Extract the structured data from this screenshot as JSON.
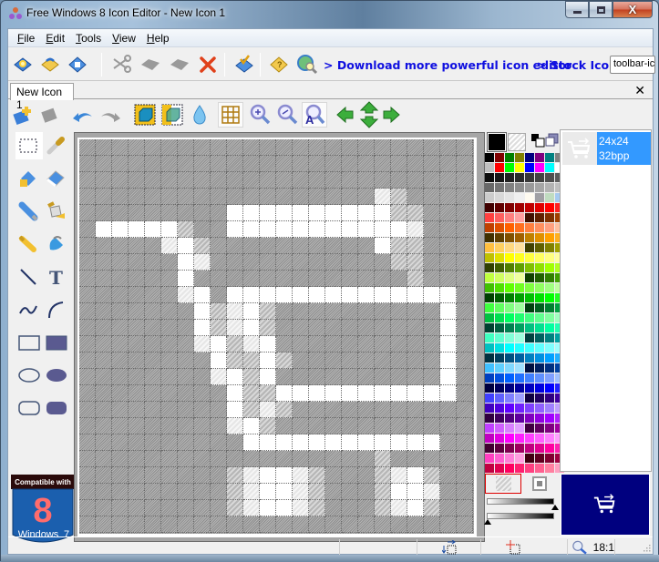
{
  "window": {
    "title": "Free Windows 8 Icon Editor - New Icon 1",
    "caption": {
      "minimize": "minimize",
      "maximize": "maximize",
      "close": "X"
    }
  },
  "menu": [
    {
      "label": "File",
      "accel": "F",
      "rest": "ile"
    },
    {
      "label": "Edit",
      "accel": "E",
      "rest": "dit"
    },
    {
      "label": "Tools",
      "accel": "T",
      "rest": "ools"
    },
    {
      "label": "View",
      "accel": "V",
      "rest": "iew"
    },
    {
      "label": "Help",
      "accel": "H",
      "rest": "elp"
    }
  ],
  "toolbar": {
    "buttons": [
      {
        "name": "new-icon",
        "icon": "new-sparkle-icon",
        "enabled": true
      },
      {
        "name": "open",
        "icon": "open-folder-icon",
        "enabled": true
      },
      {
        "name": "save",
        "icon": "save-disk-icon",
        "enabled": true
      },
      {
        "name": "cut",
        "icon": "scissors-icon",
        "enabled": false
      },
      {
        "name": "copy",
        "icon": "copy-icon",
        "enabled": false
      },
      {
        "name": "paste",
        "icon": "paste-icon",
        "enabled": false
      },
      {
        "name": "delete",
        "icon": "delete-x-icon",
        "enabled": true
      },
      {
        "name": "import",
        "icon": "import-check-icon",
        "enabled": true
      },
      {
        "name": "help",
        "icon": "help-book-icon",
        "enabled": true
      },
      {
        "name": "search",
        "icon": "globe-search-icon",
        "enabled": true
      }
    ],
    "links": [
      "> Download more powerful icon editor",
      "> Stock Icons"
    ],
    "combo_value": "toolbar-ic"
  },
  "tabs": [
    {
      "label": "New Icon 1",
      "active": true
    }
  ],
  "tab_close": "✕",
  "edit_toolbar": [
    {
      "name": "add-image",
      "icon": "add-image-icon",
      "enabled": true
    },
    {
      "name": "remove-image",
      "icon": "remove-image-icon",
      "enabled": false
    },
    {
      "name": "undo",
      "icon": "undo-icon",
      "enabled": true
    },
    {
      "name": "redo",
      "icon": "redo-icon",
      "enabled": false
    },
    {
      "name": "opaque-mode",
      "icon": "opaque-cube-icon",
      "enabled": true
    },
    {
      "name": "transparent-mode",
      "icon": "transparent-cube-icon",
      "enabled": true
    },
    {
      "name": "drop-shadow",
      "icon": "water-drop-icon",
      "enabled": true
    },
    {
      "name": "grid",
      "icon": "grid-icon",
      "enabled": true,
      "pressed": true
    },
    {
      "name": "zoom-in",
      "icon": "zoom-in-icon",
      "enabled": true
    },
    {
      "name": "zoom-out",
      "icon": "zoom-out-icon",
      "enabled": true
    },
    {
      "name": "zoom-fit",
      "icon": "zoom-fit-icon",
      "enabled": true,
      "pressed": true
    },
    {
      "name": "move-left",
      "icon": "arrow-left-icon",
      "enabled": true
    },
    {
      "name": "move-up-down",
      "icon": "arrow-up-down-icon",
      "enabled": true
    },
    {
      "name": "move-right",
      "icon": "arrow-right-icon",
      "enabled": true
    }
  ],
  "tools": [
    {
      "name": "select-rect",
      "icon": "marquee-icon",
      "active": true
    },
    {
      "name": "color-picker",
      "icon": "eyedropper-icon"
    },
    {
      "name": "eraser-fill",
      "icon": "eraser-bucket-icon"
    },
    {
      "name": "eraser",
      "icon": "eraser-icon"
    },
    {
      "name": "pencil",
      "icon": "pencil-icon"
    },
    {
      "name": "fill",
      "icon": "paint-bucket-icon"
    },
    {
      "name": "brush",
      "icon": "brush-icon"
    },
    {
      "name": "airbrush",
      "icon": "spray-icon"
    },
    {
      "name": "line",
      "icon": "line-icon"
    },
    {
      "name": "text",
      "icon": "text-icon",
      "glyph": "T"
    },
    {
      "name": "curve",
      "icon": "curve-icon"
    },
    {
      "name": "arc",
      "icon": "arc-icon"
    },
    {
      "name": "rectangle",
      "icon": "rectangle-outline-icon"
    },
    {
      "name": "filled-rectangle",
      "icon": "rectangle-filled-icon"
    },
    {
      "name": "ellipse",
      "icon": "ellipse-outline-icon"
    },
    {
      "name": "filled-ellipse",
      "icon": "ellipse-filled-icon"
    },
    {
      "name": "rounded-rectangle",
      "icon": "rounded-rect-outline-icon"
    },
    {
      "name": "filled-rounded-rectangle",
      "icon": "rounded-rect-filled-icon"
    }
  ],
  "compat_badge": {
    "top": "Compatible with",
    "number": "8",
    "bottom": "Windows",
    "suffix": "7"
  },
  "canvas": {
    "size": 24,
    "pixels": {
      "w": [
        "5:1",
        "5:2",
        "5:3",
        "5:4",
        "5:5",
        "6:6",
        "7:6",
        "8:6",
        "9:7",
        "10:7",
        "11:7",
        "12:8",
        "13:8",
        "14:9",
        "15:9",
        "16:9",
        "17:10",
        "18:10",
        "4:9",
        "4:10",
        "4:11",
        "4:12",
        "4:13",
        "4:14",
        "4:15",
        "4:16",
        "4:17",
        "4:18",
        "5:9",
        "5:10",
        "5:11",
        "5:12",
        "5:13",
        "5:14",
        "5:15",
        "5:16",
        "5:17",
        "5:18",
        "5:19",
        "6:18",
        "9:9",
        "9:10",
        "9:11",
        "9:12",
        "9:13",
        "9:14",
        "9:15",
        "9:16",
        "9:17",
        "9:18",
        "9:19",
        "9:20",
        "9:21",
        "9:22",
        "10:22",
        "11:22",
        "12:22",
        "13:22",
        "14:22",
        "15:12",
        "15:13",
        "15:14",
        "15:15",
        "15:16",
        "15:17",
        "15:18",
        "15:19",
        "15:20",
        "15:21",
        "15:22",
        "10:10",
        "11:10",
        "12:11",
        "13:11",
        "14:11",
        "18:10",
        "18:11",
        "18:12",
        "18:13",
        "18:14",
        "18:15",
        "18:16",
        "18:17",
        "18:18",
        "18:19",
        "18:20",
        "18:21",
        "20:11",
        "20:12",
        "21:11",
        "21:12",
        "22:11",
        "22:12",
        "20:20",
        "21:19",
        "21:20",
        "22:20"
      ],
      "l": [
        "3:18",
        "5:19_",
        "6:5",
        "7:7",
        "9:6",
        "9:7",
        "10:9",
        "12:10",
        "12:7",
        "14:8",
        "17:10",
        "16:11",
        "17:9",
        "6:19",
        "5:20",
        "21:21",
        "20:19",
        "22:19",
        "20:13",
        "20:10",
        "21:13",
        "21:10",
        "22:10",
        "22:13",
        "17:9_",
        "10:9_",
        "11:9"
      ],
      "s": [
        "3:19",
        "4:19",
        "5:6",
        "6:7",
        "4:20",
        "6:19",
        "7:19",
        "6:20",
        "7:20",
        "8:20",
        "10:8",
        "11:8",
        "10:11",
        "11:11",
        "13:10",
        "12:9",
        "13:9",
        "14:10",
        "15:10",
        "16:10",
        "13:12",
        "15:11",
        "16:12",
        "17:11",
        "20:9",
        "21:9",
        "22:9",
        "20:14",
        "22:14",
        "21:14",
        "20:18",
        "21:18",
        "22:18",
        "19:18",
        "20:21",
        "22:21"
      ]
    }
  },
  "palette": {
    "foreground": "#000000",
    "background": "transparent",
    "colors": [
      "#000000",
      "#800000",
      "#008000",
      "#808000",
      "#000080",
      "#800080",
      "#008080",
      "#808080",
      "#c0c0c0",
      "#ff0000",
      "#00ff00",
      "#ffff00",
      "#0000ff",
      "#ff00ff",
      "#00ffff",
      "#ffffff",
      "#0d0d0d",
      "#171717",
      "#222222",
      "#2b2b2b",
      "#383838",
      "#434343",
      "#4f4f4f",
      "#5b5b5b",
      "#686868",
      "#747474",
      "#818181",
      "#8d8d8d",
      "#9a9a9a",
      "#a6a6a6",
      "#b3b3b3",
      "#bfbfbf",
      "#cccccc",
      "#d8d8d8",
      "#e4e4e4",
      "#f0f0f0",
      "#fffbf0",
      "#a0a0a4",
      "#c0dcc0",
      "#a6caf0",
      "#400000",
      "#600000",
      "#800000",
      "#a00000",
      "#c00000",
      "#e00000",
      "#ff0000",
      "#ff2020",
      "#ff4040",
      "#ff6060",
      "#ff8080",
      "#ffa0a0",
      "#401000",
      "#602000",
      "#803000",
      "#a04000",
      "#c04000",
      "#e05000",
      "#ff6000",
      "#ff7020",
      "#ff8040",
      "#ff9060",
      "#ffa080",
      "#ffc0a0",
      "#403000",
      "#604000",
      "#805000",
      "#a06000",
      "#c08000",
      "#e09000",
      "#ffa000",
      "#ffb020",
      "#ffc040",
      "#ffd060",
      "#ffd880",
      "#ffe0a0",
      "#404000",
      "#606000",
      "#808000",
      "#a0a000",
      "#c0c000",
      "#e0e000",
      "#ffff00",
      "#ffff20",
      "#ffff40",
      "#ffff60",
      "#ffff80",
      "#ffffa0",
      "#304000",
      "#406000",
      "#508000",
      "#60a000",
      "#80c000",
      "#90e000",
      "#a0ff00",
      "#b0ff20",
      "#c0ff40",
      "#d0ff60",
      "#e0ff80",
      "#f0ffa0",
      "#104000",
      "#206000",
      "#308000",
      "#40a000",
      "#40c000",
      "#50e000",
      "#60ff00",
      "#70ff20",
      "#80ff40",
      "#90ff60",
      "#a0ff80",
      "#c0ffa0",
      "#004000",
      "#006000",
      "#008000",
      "#00a000",
      "#00c000",
      "#00e000",
      "#00ff00",
      "#20ff20",
      "#40ff40",
      "#60ff60",
      "#80ff80",
      "#a0ffa0",
      "#004010",
      "#006020",
      "#008030",
      "#00a040",
      "#00c040",
      "#00e050",
      "#00ff60",
      "#20ff70",
      "#40ff80",
      "#60ff90",
      "#80ffa0",
      "#a0ffc0",
      "#004030",
      "#006040",
      "#008050",
      "#00a060",
      "#00c080",
      "#00e090",
      "#00ffa0",
      "#20ffb0",
      "#40ffc0",
      "#60ffd0",
      "#80ffd8",
      "#a0ffe0",
      "#004040",
      "#006060",
      "#008080",
      "#00a0a0",
      "#00c0c0",
      "#00e0e0",
      "#00ffff",
      "#20ffff",
      "#40ffff",
      "#60ffff",
      "#80ffff",
      "#a0ffff",
      "#003040",
      "#004060",
      "#005080",
      "#0060a0",
      "#0080c0",
      "#0090e0",
      "#00a0ff",
      "#20b0ff",
      "#40c0ff",
      "#60d0ff",
      "#80d8ff",
      "#a0e0ff",
      "#001040",
      "#002060",
      "#003080",
      "#0040a0",
      "#0040c0",
      "#0050e0",
      "#0060ff",
      "#2070ff",
      "#4080ff",
      "#6090ff",
      "#80a0ff",
      "#a0c0ff",
      "#000040",
      "#000060",
      "#000080",
      "#0000a0",
      "#0000c0",
      "#0000e0",
      "#0000ff",
      "#2020ff",
      "#4040ff",
      "#6060ff",
      "#8080ff",
      "#a0a0ff",
      "#100040",
      "#200060",
      "#300080",
      "#4000a0",
      "#4000c0",
      "#5000e0",
      "#6000ff",
      "#7020ff",
      "#8040ff",
      "#9060ff",
      "#a080ff",
      "#c0a0ff",
      "#300040",
      "#400060",
      "#500080",
      "#6000a0",
      "#8000c0",
      "#9000e0",
      "#a000ff",
      "#b020ff",
      "#c040ff",
      "#d060ff",
      "#d880ff",
      "#e0a0ff",
      "#400040",
      "#600060",
      "#800080",
      "#a000a0",
      "#c000c0",
      "#e000e0",
      "#ff00ff",
      "#ff20ff",
      "#ff40ff",
      "#ff60ff",
      "#ff80ff",
      "#ffa0ff",
      "#400030",
      "#600040",
      "#800050",
      "#a00060",
      "#c00080",
      "#e00090",
      "#ff00a0",
      "#ff20b0",
      "#ff40c0",
      "#ff60d0",
      "#ff80d8",
      "#ffa0e0",
      "#400010",
      "#600020",
      "#800030",
      "#a00040",
      "#c00040",
      "#e00050",
      "#ff0060",
      "#ff2070",
      "#ff4080",
      "#ff6090",
      "#ff80a0",
      "#ffa0c0"
    ]
  },
  "layers": [
    {
      "size": "24x24",
      "depth": "32bpp",
      "selected": true
    }
  ],
  "preview_bg": "#00007f",
  "status": {
    "zoom": "18:1"
  }
}
